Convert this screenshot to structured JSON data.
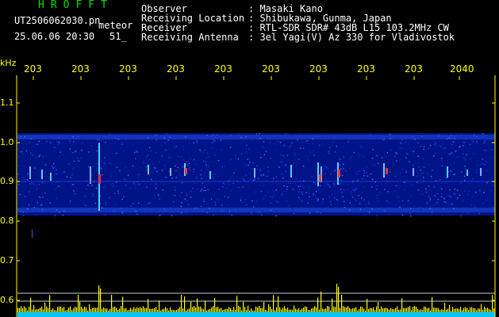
{
  "header": {
    "logo": "HROFFT",
    "file_name": "UT2506062030.pn",
    "meteor_label": "meteor",
    "date_time": "25.06.06 20:30",
    "count": "51_"
  },
  "meta": [
    {
      "key": "Observer",
      "value": ": Masaki Kano"
    },
    {
      "key": "Receiving Location",
      "value": ": Shibukawa, Gunma, Japan"
    },
    {
      "key": "Receiver",
      "value": ": RTL-SDR SDR# 43dB L15 103.2MHz CW"
    },
    {
      "key": "Receiving Antenna",
      "value": ": 3el Yagi(V) Az 330 for Vladivostok"
    }
  ],
  "y_axis": {
    "unit": "kHz",
    "ticks": [
      "1.1",
      "1.0",
      "0.9",
      "0.8",
      "0.7",
      "0.6"
    ]
  },
  "x_axis": {
    "ticks": [
      "203",
      "203",
      "203",
      "203",
      "203",
      "203",
      "203",
      "203",
      "203",
      "2040"
    ]
  },
  "colors": {
    "background": "#000000",
    "axis": "#ffff00",
    "logo": "#00e000",
    "band": "#0010a0",
    "signal": "#00c0ff",
    "echo": "#ff2020",
    "histogram": "#ffff00"
  }
}
